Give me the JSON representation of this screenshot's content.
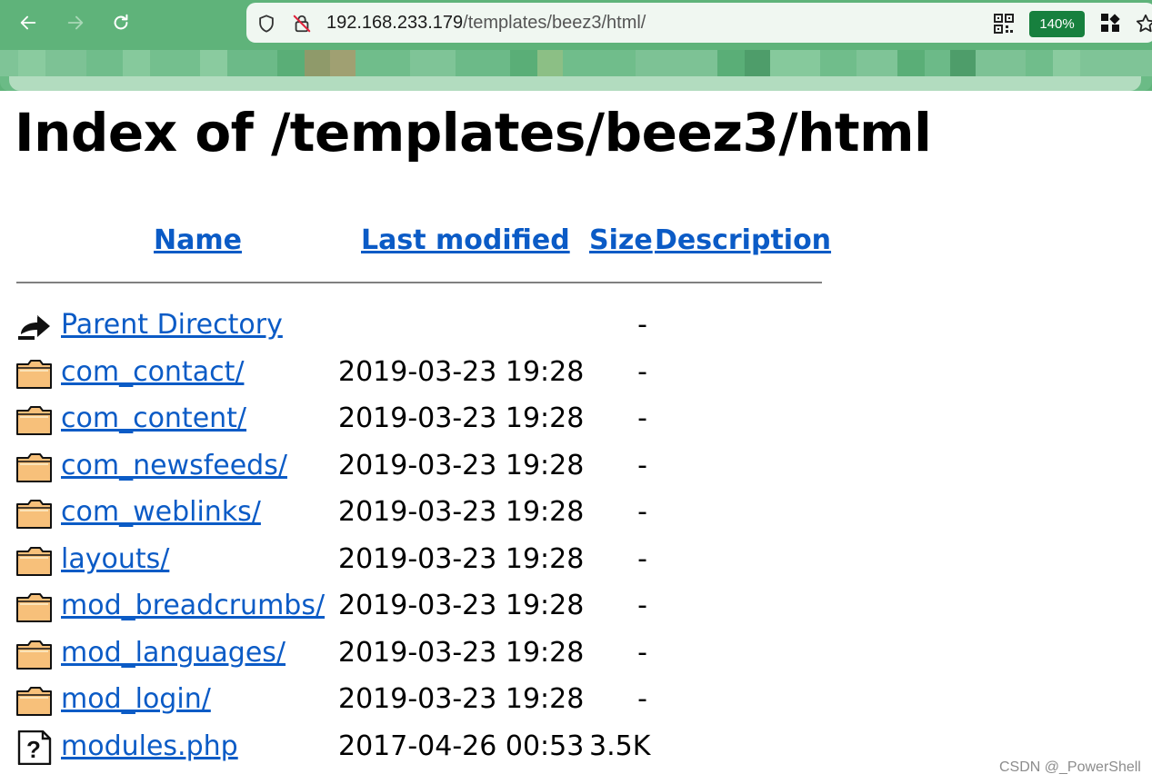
{
  "browser": {
    "url_host": "192.168.233.179",
    "url_path": "/templates/beez3/html/",
    "zoom": "140%"
  },
  "page": {
    "title": "Index of /templates/beez3/html",
    "columns": {
      "name": "Name",
      "last_modified": "Last modified",
      "size": "Size",
      "description": "Description"
    },
    "rows": [
      {
        "icon": "parent-directory-icon",
        "name": "Parent Directory",
        "date": "",
        "size": "-"
      },
      {
        "icon": "folder-icon",
        "name": "com_contact/",
        "date": "2019-03-23 19:28",
        "size": "-"
      },
      {
        "icon": "folder-icon",
        "name": "com_content/",
        "date": "2019-03-23 19:28",
        "size": "-"
      },
      {
        "icon": "folder-icon",
        "name": "com_newsfeeds/",
        "date": "2019-03-23 19:28",
        "size": "-"
      },
      {
        "icon": "folder-icon",
        "name": "com_weblinks/",
        "date": "2019-03-23 19:28",
        "size": "-"
      },
      {
        "icon": "folder-icon",
        "name": "layouts/",
        "date": "2019-03-23 19:28",
        "size": "-"
      },
      {
        "icon": "folder-icon",
        "name": "mod_breadcrumbs/",
        "date": "2019-03-23 19:28",
        "size": "-"
      },
      {
        "icon": "folder-icon",
        "name": "mod_languages/",
        "date": "2019-03-23 19:28",
        "size": "-"
      },
      {
        "icon": "folder-icon",
        "name": "mod_login/",
        "date": "2019-03-23 19:28",
        "size": "-"
      },
      {
        "icon": "unknown-file-icon",
        "name": "modules.php",
        "date": "2017-04-26 00:53",
        "size": "3.5K"
      }
    ]
  },
  "watermark": "CSDN @_PowerShell",
  "colors": {
    "toolbar": "#5fb37a",
    "link": "#0b5bc6",
    "zoom_badge": "#17803e",
    "folder": "#f7c07a"
  }
}
